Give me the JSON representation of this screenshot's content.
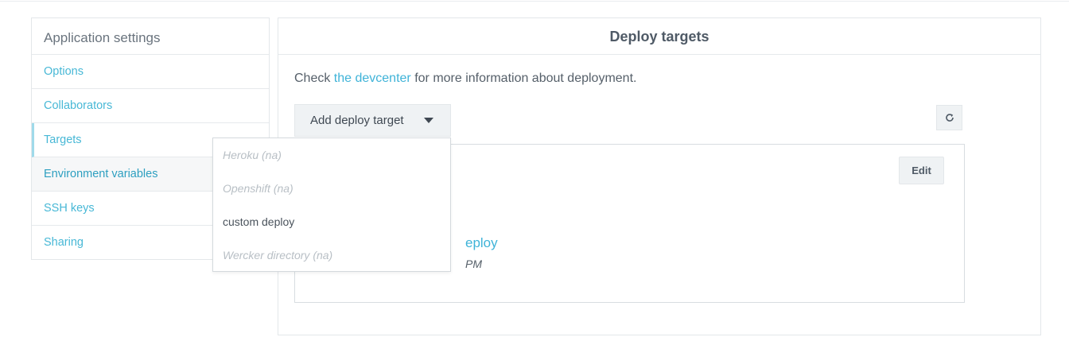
{
  "sidebar": {
    "title": "Application settings",
    "items": [
      {
        "label": "Options"
      },
      {
        "label": "Collaborators"
      },
      {
        "label": "Targets"
      },
      {
        "label": "Environment variables"
      },
      {
        "label": "SSH keys"
      },
      {
        "label": "Sharing"
      }
    ],
    "active_index": 2,
    "hover_index": 3
  },
  "panel": {
    "title": "Deploy targets",
    "info_prefix": "Check ",
    "info_link": "the devcenter",
    "info_suffix": " for more information about deployment.",
    "add_button_label": "Add deploy target",
    "refresh_icon": "refresh-icon",
    "card": {
      "edit_label": "Edit",
      "link_text_visible": "eploy",
      "time_text_visible": "PM"
    }
  },
  "dropdown": {
    "items": [
      {
        "label": "Heroku (na)",
        "disabled": true
      },
      {
        "label": "Openshift (na)",
        "disabled": true
      },
      {
        "label": "custom deploy",
        "disabled": false
      },
      {
        "label": "Wercker directory (na)",
        "disabled": true
      }
    ]
  },
  "colors": {
    "link": "#3fb3d8",
    "button_bg": "#eff2f4",
    "border": "#e3e7ea",
    "active_indicator": "#9fdaea"
  }
}
